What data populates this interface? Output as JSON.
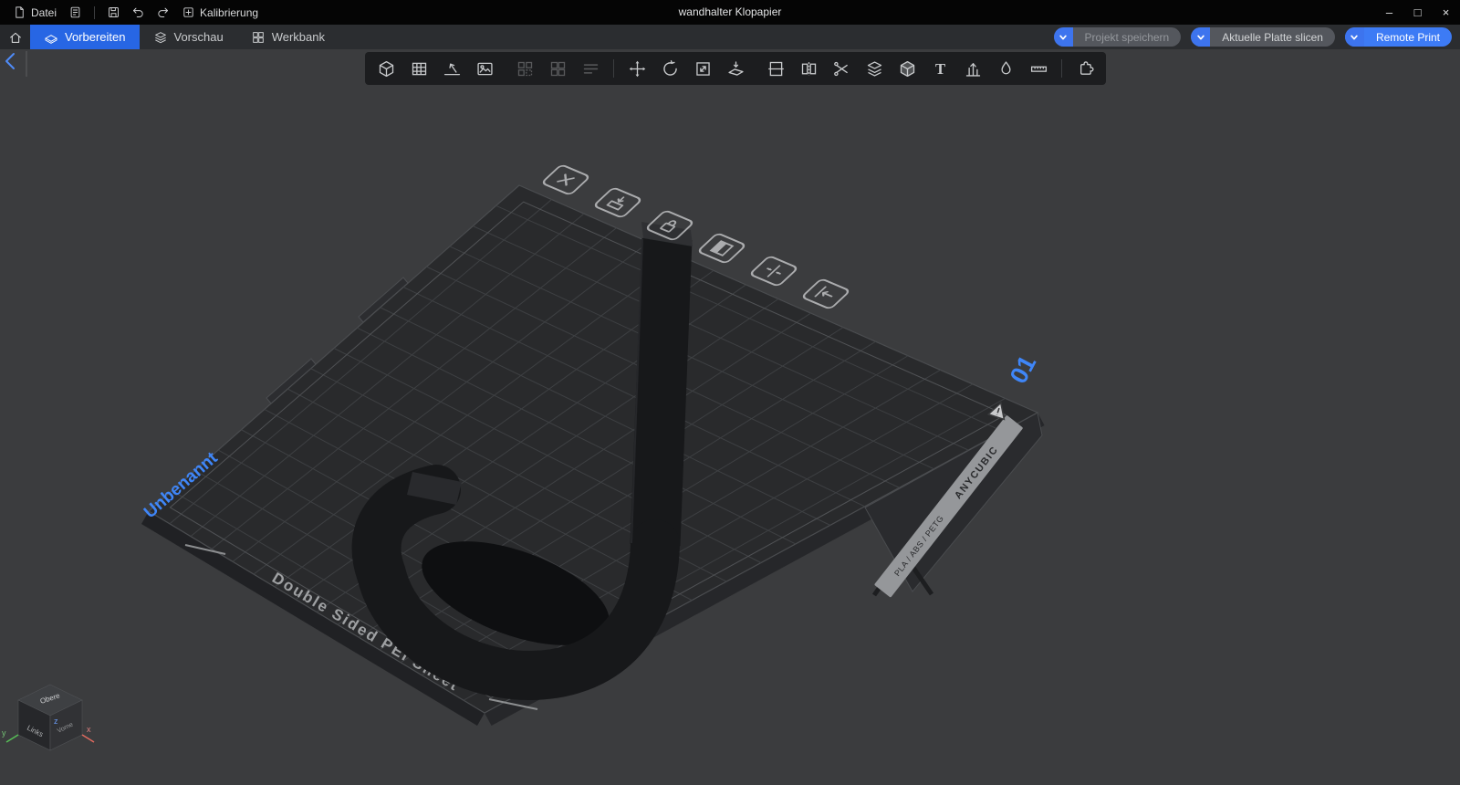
{
  "titlebar": {
    "file_menu": "Datei",
    "calibration": "Kalibrierung",
    "title": "wandhalter Klopapier",
    "minimize": "–",
    "maximize": "□",
    "close": "×",
    "icons": [
      "document-icon",
      "journal-icon",
      "save-icon",
      "undo-icon",
      "redo-icon",
      "calibration-icon"
    ]
  },
  "tabbar": {
    "tabs": [
      {
        "label": "Vorbereiten",
        "active": true,
        "icon": "prepare-icon"
      },
      {
        "label": "Vorschau",
        "active": false,
        "icon": "preview-layers-icon"
      },
      {
        "label": "Werkbank",
        "active": false,
        "icon": "workbench-grid-icon"
      }
    ],
    "actions": [
      {
        "label": "Projekt speichern",
        "style": "gray-dim"
      },
      {
        "label": "Aktuelle Platte slicen",
        "style": "gray"
      },
      {
        "label": "Remote Print",
        "style": "blue"
      }
    ]
  },
  "toolbar": {
    "groups": [
      {
        "disabled": false,
        "items": [
          {
            "name": "add-model",
            "icon": "cube"
          },
          {
            "name": "add-plate",
            "icon": "plate-grid"
          },
          {
            "name": "auto-orient",
            "icon": "orient-ramp"
          },
          {
            "name": "add-image",
            "icon": "image"
          }
        ]
      },
      {
        "disabled": true,
        "items": [
          {
            "name": "arrange-all",
            "icon": "arrange"
          },
          {
            "name": "arrange-plate",
            "icon": "arrange-grid"
          },
          {
            "name": "fill-bed",
            "icon": "rows"
          }
        ]
      },
      {
        "disabled": false,
        "items": [
          {
            "name": "move",
            "icon": "move"
          },
          {
            "name": "rotate",
            "icon": "rotate"
          },
          {
            "name": "scale",
            "icon": "scale"
          },
          {
            "name": "place-on-face",
            "icon": "place-face"
          }
        ]
      },
      {
        "disabled": false,
        "items": [
          {
            "name": "split-objects",
            "icon": "split"
          },
          {
            "name": "mirror",
            "icon": "mirror"
          },
          {
            "name": "cut",
            "icon": "cut"
          },
          {
            "name": "variable-layer-height",
            "icon": "layers"
          },
          {
            "name": "mesh-edit",
            "icon": "solid-cube"
          },
          {
            "name": "text-tool",
            "icon": "text"
          },
          {
            "name": "support-paint",
            "icon": "support"
          },
          {
            "name": "seam-paint",
            "icon": "seam"
          },
          {
            "name": "measure",
            "icon": "measure"
          }
        ]
      },
      {
        "disabled": false,
        "items": [
          {
            "name": "plugin",
            "icon": "puzzle"
          }
        ]
      }
    ]
  },
  "viewport": {
    "plate": {
      "name_label": "Unbenannt",
      "plate_number": "01",
      "sheet_label": "Double Sided PEI Sheet",
      "brand": "ANYCUBIC",
      "materials": "PLA / ABS / PETG"
    },
    "plate_actions": [
      {
        "name": "delete-plate",
        "icon": "delete"
      },
      {
        "name": "auto-orient-plate",
        "icon": "orient"
      },
      {
        "name": "lock-plate",
        "icon": "lock"
      },
      {
        "name": "plate-settings",
        "icon": "fill"
      },
      {
        "name": "align-plate",
        "icon": "align"
      },
      {
        "name": "move-plate-front",
        "icon": "edge"
      }
    ],
    "nav_cube": {
      "top": "Obere",
      "left": "Links",
      "front": "Vorne",
      "axes": {
        "x": "x",
        "y": "y",
        "z": "z"
      }
    }
  },
  "colors": {
    "accent_tab_blue": "#2766e4",
    "button_blue": "#3d7bf5",
    "label_blue": "#3f86f8",
    "viewport_bg": "#3b3c3e",
    "plate_fill": "#292a2c",
    "titlebar_bg": "#050505"
  }
}
